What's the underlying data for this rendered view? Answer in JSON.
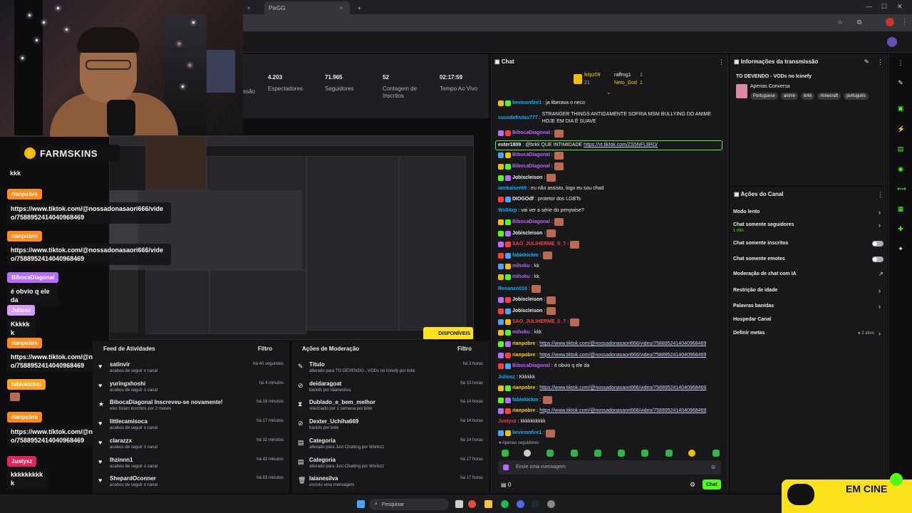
{
  "browser": {
    "tab1_label": "",
    "tab2_label": "PixGG",
    "new_tab": "+"
  },
  "farmskins": {
    "label": "FARMSKINS"
  },
  "overlay_chat": [
    {
      "user": "",
      "message": "kkk"
    },
    {
      "user": "rianpobre",
      "message": "https://www.tiktok.com/@nossadonasaori666/video/7588952414040968469"
    },
    {
      "user": "rianpobre",
      "message": "https://www.tiktok.com/@nossadonasaori666/video/7588952414040968469"
    },
    {
      "user": "BibocaDiagonal",
      "message": "é obvio q ele da"
    },
    {
      "user": "Juliosz",
      "message": "Kkkkkk"
    },
    {
      "user": "rianpobre",
      "message": "https://www.tiktok.com/@nossadonasaori666/video/7588952414040968469"
    },
    {
      "user": "fabiokickm",
      "message": ""
    },
    {
      "user": "rianpobre",
      "message": "https://www.tiktok.com/@nossadonasaori666/video/7588952414040968469"
    },
    {
      "user": "Justyxz",
      "message": "kkkkkkkkkk"
    }
  ],
  "stats": [
    {
      "value": "",
      "label": "ssão"
    },
    {
      "value": "4.203",
      "label": "Espectadores"
    },
    {
      "value": "71.965",
      "label": "Seguidores"
    },
    {
      "value": "52",
      "label": "Contagem de Inscritos"
    },
    {
      "value": "02:17:59",
      "label": "Tempo Ao Vivo"
    }
  ],
  "activity_feed": {
    "title": "Feed de Atividades",
    "filter": "Filtro",
    "items": [
      {
        "name": "satinvir",
        "sub": "acabou de seguir o canal",
        "time": "há 40 segundos"
      },
      {
        "name": "yuringxhoshi",
        "sub": "acabou de seguir o canal",
        "time": "há 4 minutos"
      },
      {
        "name": "BibocaDiagonal Inscreveu-se novamente!",
        "sub": "eles foram inscritos por 2 meses",
        "time": "há 16 minutos"
      },
      {
        "name": "littlecamisoca",
        "sub": "acabou de seguir o canal",
        "time": "há 17 minutos"
      },
      {
        "name": "clarazzx",
        "sub": "acabou de seguir o canal",
        "time": "há 32 minutos"
      },
      {
        "name": "lhzinnn1",
        "sub": "acabou de seguir o canal",
        "time": "há 42 minutos"
      },
      {
        "name": "ShepardOconner",
        "sub": "acabou de seguir o canal",
        "time": "há 53 minutos"
      }
    ]
  },
  "moderation": {
    "title": "Ações de Moderação",
    "filter": "Filtro",
    "items": [
      {
        "name": "Título",
        "sub": "alterado para TO DEVENDO - VODs no Icinefy por brkk",
        "time": "há 3 horas"
      },
      {
        "name": "deidaragoat",
        "sub": "banido por laianesilva",
        "time": "há 13 horas"
      },
      {
        "name": "Dublado_e_bem_melhor",
        "sub": "silenciado por 1 semana por brkk",
        "time": "há 14 horas"
      },
      {
        "name": "Dexter_Uchiha669",
        "sub": "banido por brkk",
        "time": "há 14 horas"
      },
      {
        "name": "Categoria",
        "sub": "alterado para Just Chatting por Wonkzz",
        "time": "há 14 horas"
      },
      {
        "name": "Categoria",
        "sub": "alterado para Just Chatting por Wonkzz",
        "time": "há 17 horas"
      },
      {
        "name": "laianesilva",
        "sub": "excluiu uma mensagem",
        "time": "há 17 horas"
      }
    ]
  },
  "chat": {
    "title": "Chat",
    "top_gifters": [
      {
        "name": "felpz09",
        "count": "21"
      },
      {
        "name": "raffmg1",
        "count": "1"
      },
      {
        "name": "Neto_God",
        "count": "1"
      }
    ],
    "messages": [
      {
        "user": "kevinonfire1",
        "color": "#00b5ff",
        "text": "ja liberava o neco",
        "emote": false
      },
      {
        "user": "sucodefrutas777",
        "color": "#00b5ff",
        "text": "STRANGER THINGS ANTIGAMENTE SOFRIA MSM BULLYING DO ANIME HOJE EM DIA É SUAVE",
        "emote": false
      },
      {
        "user": "BibocaDiagonal",
        "color": "#c060ff",
        "text": "",
        "emote": true
      },
      {
        "user": "ester1809",
        "color": "#efeff1",
        "text": "@brkk QUE INTIMIDADE",
        "link": "https://vt.tiktok.com/ZS5NFL8RD/",
        "emote": false
      },
      {
        "user": "BibocaDiagonal",
        "color": "#c060ff",
        "text": "",
        "emote": true
      },
      {
        "user": "BibocaDiagonal",
        "color": "#c060ff",
        "text": "",
        "emote": true
      },
      {
        "user": "Jobiscleison",
        "color": "#efeff1",
        "text": "",
        "emote": true
      },
      {
        "user": "iamkaiser69",
        "color": "#00b5ff",
        "text": "eu não assisto, logo eu sou chad",
        "emote": false
      },
      {
        "user": "DIOGOdf",
        "color": "#efeff1",
        "text": "protetor dos LGBTs",
        "emote": false
      },
      {
        "user": "Ws04xp",
        "color": "#00b5ff",
        "text": "vai ver a série do penywise?",
        "emote": false
      },
      {
        "user": "BibocaDiagonal",
        "color": "#c060ff",
        "text": "",
        "emote": true
      },
      {
        "user": "Jobiscleison",
        "color": "#efeff1",
        "text": "",
        "emote": true
      },
      {
        "user": "SAO_JULIHERME_0_7",
        "color": "#ff3d3d",
        "text": "",
        "emote": true
      },
      {
        "user": "fabiokickm",
        "color": "#00b5ff",
        "text": "",
        "emote": true
      },
      {
        "user": "mihoku",
        "color": "#c060ff",
        "text": "kk",
        "emote": false
      },
      {
        "user": "mihoku",
        "color": "#c060ff",
        "text": "kk",
        "emote": false
      },
      {
        "user": "Renanzn010",
        "color": "#00b5ff",
        "text": "",
        "emote": true
      },
      {
        "user": "Jobiscleison",
        "color": "#efeff1",
        "text": "",
        "emote": true
      },
      {
        "user": "Jobiscleison",
        "color": "#efeff1",
        "text": "",
        "emote": true
      },
      {
        "user": "SAO_JULIHERME_0_7",
        "color": "#ff3d3d",
        "text": "",
        "emote": true
      },
      {
        "user": "mihoku",
        "color": "#c060ff",
        "text": "kkk",
        "emote": false
      },
      {
        "user": "rianpobre",
        "color": "#ffd000",
        "text": "",
        "link": "https://www.tiktok.com/@nossadonasaori666/video/7588952414040968469",
        "emote": false
      },
      {
        "user": "rianpobre",
        "color": "#ffd000",
        "text": "",
        "link": "https://www.tiktok.com/@nossadonasaori666/video/7588952414040968469",
        "emote": false
      },
      {
        "user": "BibocaDiagonal",
        "color": "#c060ff",
        "text": "é obvio q ele da",
        "emote": false
      },
      {
        "user": "Juliosz",
        "color": "#00b5ff",
        "text": "Kkkkkk",
        "emote": false
      },
      {
        "user": "rianpobre",
        "color": "#ffd000",
        "text": "",
        "link": "https://www.tiktok.com/@nossadonasaori666/video/7588952414040968469",
        "emote": false
      },
      {
        "user": "fabiokickm",
        "color": "#00b5ff",
        "text": "",
        "emote": true
      },
      {
        "user": "rianpobre",
        "color": "#ffd000",
        "text": "",
        "link": "https://www.tiktok.com/@nossadonasaori666/video/7588952414040968469",
        "emote": false
      },
      {
        "user": "Justyxz",
        "color": "#ff3d3d",
        "text": "kkkkkkkkkk",
        "emote": false
      },
      {
        "user": "kevinonfire1",
        "color": "#00b5ff",
        "text": "",
        "emote": true
      }
    ],
    "followers_only": "Apenas seguidores",
    "input_placeholder": "Envie uma mensagem",
    "points": "0",
    "send_label": "Chat"
  },
  "stream_info": {
    "title": "Informações da transmissão",
    "stream_title": "TO DEVENDO - VODs no Icinefy",
    "category": "Apenas Conversa",
    "tags": [
      "Portuguese",
      "anime",
      "brkk",
      "minecraft",
      "português"
    ]
  },
  "channel_actions": {
    "title": "Ações do Canal",
    "items": [
      {
        "label": "Modo lento",
        "type": "chevron"
      },
      {
        "label": "Chat somente seguidores",
        "sub": "1 min",
        "type": "chevron"
      },
      {
        "label": "Chat somente inscritos",
        "type": "toggle"
      },
      {
        "label": "Chat somente emotes",
        "type": "toggle"
      },
      {
        "label": "Moderação de chat com IA",
        "type": "external"
      },
      {
        "label": "Restrição de idade",
        "type": "chevron"
      },
      {
        "label": "Palavras banidas",
        "type": "chevron"
      },
      {
        "label": "Hospedar Canal",
        "type": "none"
      },
      {
        "label": "Definir metas",
        "sub": "2 ativo",
        "type": "chevron"
      }
    ]
  },
  "share_overlay": {
    "label": "DISPONÍVEIS"
  },
  "taskbar": {
    "search": "Pesquisar"
  },
  "emcine": {
    "label": "EM CINE"
  },
  "colors": {
    "accent": "#53fc18",
    "link": "#cfd8ff",
    "panel": "#18181b",
    "brand_yellow": "#fde21b"
  }
}
